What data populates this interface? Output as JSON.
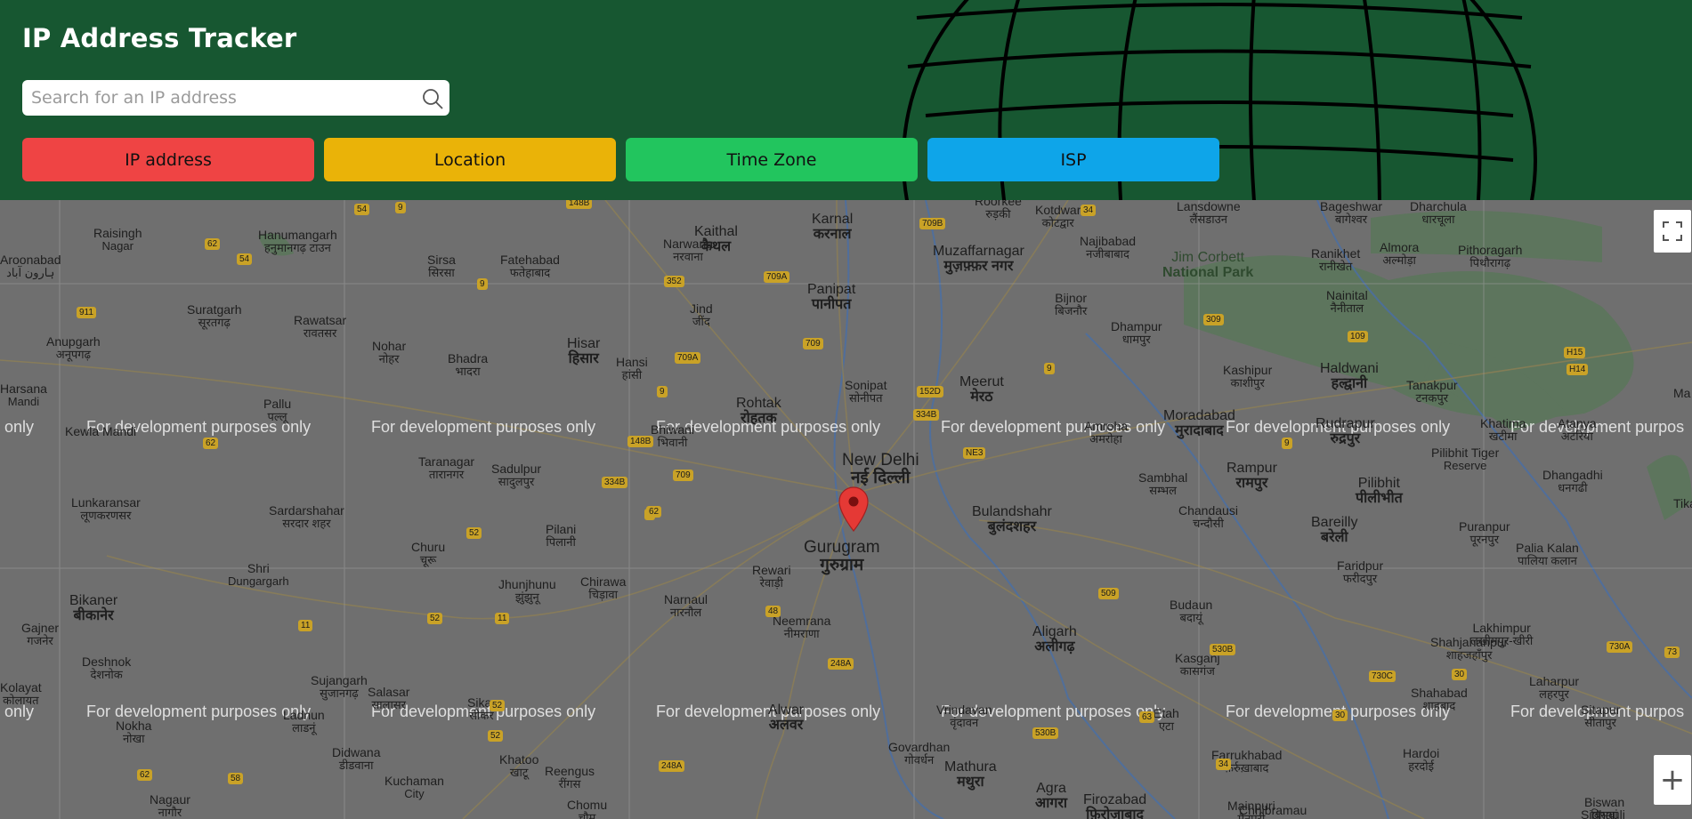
{
  "app": {
    "title": "IP Address Tracker"
  },
  "search": {
    "placeholder": "Search for an IP address",
    "icon": "search-icon"
  },
  "cards": [
    {
      "label": "IP address",
      "color": "#ef4444"
    },
    {
      "label": "Location",
      "color": "#eab308"
    },
    {
      "label": "Time Zone",
      "color": "#22c55e"
    },
    {
      "label": "ISP",
      "color": "#0ea5e9"
    }
  ],
  "map": {
    "watermark": "For development purposes only",
    "watermark_partial": "only",
    "watermark_cut": "For development purpos",
    "places": [
      {
        "en": "Kaithal",
        "hi": "कैथल"
      },
      {
        "en": "Karnal",
        "hi": "करनाल"
      },
      {
        "en": "Roorkee",
        "hi": "रुड़की"
      },
      {
        "en": "Muzaffarnagar",
        "hi": "मुज़फ़्फ़र नगर"
      },
      {
        "en": "Kotdwar",
        "hi": "कोटद्वार"
      },
      {
        "en": "Lansdowne",
        "hi": "लैंसडाउन"
      },
      {
        "en": "Najibabad",
        "hi": "नजीबाबाद"
      },
      {
        "en": "Jim Corbett",
        "hi": "National Park"
      },
      {
        "en": "Bageshwar",
        "hi": "बागेश्वर"
      },
      {
        "en": "Dharchula",
        "hi": "धारचूला"
      },
      {
        "en": "Raisingh",
        "hi": "Nagar"
      },
      {
        "en": "Hanumangarh",
        "hi": "हनुमानगढ़ टाउन"
      },
      {
        "en": "Sirsa",
        "hi": "सिरसा"
      },
      {
        "en": "Fatehabad",
        "hi": "फतेहाबाद"
      },
      {
        "en": "Narwana",
        "hi": "नरवाना"
      },
      {
        "en": "Panipat",
        "hi": "पानीपत"
      },
      {
        "en": "Bijnor",
        "hi": "बिजनौर"
      },
      {
        "en": "Ranikhet",
        "hi": "रानीखेत"
      },
      {
        "en": "Almora",
        "hi": "अल्मोड़ा"
      },
      {
        "en": "Pithoragarh",
        "hi": "पिथौरागढ़"
      },
      {
        "en": "Suratgarh",
        "hi": "सूरतगढ़"
      },
      {
        "en": "Rawatsar",
        "hi": "रावतसर"
      },
      {
        "en": "Jind",
        "hi": "जींद"
      },
      {
        "en": "Dhampur",
        "hi": "धामपुर"
      },
      {
        "en": "Nainital",
        "hi": "नैनीताल"
      },
      {
        "en": "Anupgarh",
        "hi": "अनूपगढ़"
      },
      {
        "en": "Nohar",
        "hi": "नोहर"
      },
      {
        "en": "Hisar",
        "hi": "हिसार"
      },
      {
        "en": "Hansi",
        "hi": "हांसी"
      },
      {
        "en": "Bhadra",
        "hi": "भादरा"
      },
      {
        "en": "Kashipur",
        "hi": "काशीपुर"
      },
      {
        "en": "Haldwani",
        "hi": "हल्द्वानी"
      },
      {
        "en": "Rohtak",
        "hi": "रोहतक"
      },
      {
        "en": "Sonipat",
        "hi": "सोनीपत"
      },
      {
        "en": "Meerut",
        "hi": "मेरठ"
      },
      {
        "en": "Pallu",
        "hi": "पल्लू"
      },
      {
        "en": "Tanakpur",
        "hi": "टनकपुर"
      },
      {
        "en": "Moradabad",
        "hi": "मुरादाबाद"
      },
      {
        "en": "Rudrapur",
        "hi": "रुद्रपुर"
      },
      {
        "en": "Bhiwani",
        "hi": "भिवानी"
      },
      {
        "en": "Amroha",
        "hi": "अमरोहा"
      },
      {
        "en": "Khatima",
        "hi": "खटीमा"
      },
      {
        "en": "New Delhi",
        "hi": "नई दिल्ली"
      },
      {
        "en": "Taranagar",
        "hi": "तारानगर"
      },
      {
        "en": "Sadulpur",
        "hi": "सादुलपुर"
      },
      {
        "en": "Rampur",
        "hi": "रामपुर"
      },
      {
        "en": "Pilibhit",
        "hi": "पीलीभीत"
      },
      {
        "en": "Sambhal",
        "hi": "सम्भल"
      },
      {
        "en": "Pilibhit Tiger",
        "hi": "Reserve"
      },
      {
        "en": "Dhangadhi",
        "hi": "धनगढी"
      },
      {
        "en": "Lunkaransar",
        "hi": "लूणकरणसर"
      },
      {
        "en": "Sardarshahar",
        "hi": "सरदार शहर"
      },
      {
        "en": "Bulandshahr",
        "hi": "बुलंदशहर"
      },
      {
        "en": "Chandausi",
        "hi": "चन्दौसी"
      },
      {
        "en": "Bareilly",
        "hi": "बरेली"
      },
      {
        "en": "Puranpur",
        "hi": "पूरनपुर"
      },
      {
        "en": "Pilani",
        "hi": "पिलानी"
      },
      {
        "en": "Gurugram",
        "hi": "गुरुग्राम"
      },
      {
        "en": "Churu",
        "hi": "चूरू"
      },
      {
        "en": "Palia Kalan",
        "hi": "पालिया कलान"
      },
      {
        "en": "Shri",
        "hi": "Dungargarh"
      },
      {
        "en": "Rewari",
        "hi": "रेवाड़ी"
      },
      {
        "en": "Faridpur",
        "hi": "फरीदपुर"
      },
      {
        "en": "Jhunjhunu",
        "hi": "झुंझुनू"
      },
      {
        "en": "Chirawa",
        "hi": "चिड़ावा"
      },
      {
        "en": "Bikaner",
        "hi": "बीकानेर"
      },
      {
        "en": "Narnaul",
        "hi": "नारनौल"
      },
      {
        "en": "Aligarh",
        "hi": "अलीगढ़"
      },
      {
        "en": "Budaun",
        "hi": "बदायूं"
      },
      {
        "en": "Neemrana",
        "hi": "नीमराणा"
      },
      {
        "en": "Lakhimpur",
        "hi": "लखीमपुर-खीरी"
      },
      {
        "en": "Gajner",
        "hi": "गजनेर"
      },
      {
        "en": "Shahjahanpur",
        "hi": "शाहजहाँपुर"
      },
      {
        "en": "Deshnok",
        "hi": "देशनोक"
      },
      {
        "en": "Kasganj",
        "hi": "कासगंज"
      },
      {
        "en": "Laharpur",
        "hi": "लहरपुर"
      },
      {
        "en": "Sujangarh",
        "hi": "सुजानगढ़"
      },
      {
        "en": "Salasar",
        "hi": "सालासर"
      },
      {
        "en": "Kolayat",
        "hi": "कोलायत"
      },
      {
        "en": "Shahabad",
        "hi": "शाहबाद"
      },
      {
        "en": "Sitapur",
        "hi": "सीतापुर"
      },
      {
        "en": "Alwar",
        "hi": "अलवर"
      },
      {
        "en": "Vrindavan",
        "hi": "वृंदावन"
      },
      {
        "en": "Etah",
        "hi": "एटा"
      },
      {
        "en": "Sikar",
        "hi": "सीकर"
      },
      {
        "en": "Ladnun",
        "hi": "लाडनूं"
      },
      {
        "en": "Farrukhabad",
        "hi": "फ़र्रुख़ाबाद"
      },
      {
        "en": "Hardoi",
        "hi": "हरदोई"
      },
      {
        "en": "Nokha",
        "hi": "नोखा"
      },
      {
        "en": "Govardhan",
        "hi": "गोवर्धन"
      },
      {
        "en": "Didwana",
        "hi": "डीडवाना"
      },
      {
        "en": "Khatoo",
        "hi": "खाटू"
      },
      {
        "en": "Reengus",
        "hi": "रींगस"
      },
      {
        "en": "Mathura",
        "hi": "मथुरा"
      },
      {
        "en": "Agra",
        "hi": "आगरा"
      },
      {
        "en": "Firozabad",
        "hi": "फ़िरोज़ाबाद"
      },
      {
        "en": "Mainpuri",
        "hi": "मैनपुरी"
      },
      {
        "en": "Biswan",
        "hi": "बिसवां"
      },
      {
        "en": "Kuchaman",
        "hi": "City"
      },
      {
        "en": "Nagaur",
        "hi": "नागौर"
      },
      {
        "en": "Chomu",
        "hi": "चौमू"
      },
      {
        "en": "Chhibramau",
        "hi": ""
      },
      {
        "en": "Sidhauli",
        "hi": ""
      },
      {
        "en": "Aroonabad",
        "hi": "ہارون آباد"
      },
      {
        "en": "Harsana",
        "hi": "Mandi"
      },
      {
        "en": "Kewla Mandi",
        "hi": ""
      },
      {
        "en": "Atanya",
        "hi": "अटरिया"
      },
      {
        "en": "Tikapur",
        "hi": ""
      },
      {
        "en": "Ma",
        "hi": ""
      }
    ],
    "shields": [
      "54",
      "9",
      "148B",
      "709B",
      "34",
      "62",
      "54",
      "911",
      "9",
      "352",
      "709A",
      "709",
      "H15",
      "H14",
      "309",
      "109",
      "9",
      "709A",
      "9",
      "148B",
      "709",
      "334B",
      "334B",
      "152D",
      "9",
      "62",
      "NE3",
      "62",
      "52",
      "11",
      "48",
      "52",
      "11",
      "509",
      "530B",
      "730C",
      "730A",
      "30",
      "248A",
      "52",
      "52",
      "58",
      "62",
      "248A",
      "530B",
      "34",
      "73",
      "30",
      "9",
      "63"
    ]
  },
  "controls": {
    "fullscreen": "fullscreen-icon",
    "zoom_in": "+"
  }
}
